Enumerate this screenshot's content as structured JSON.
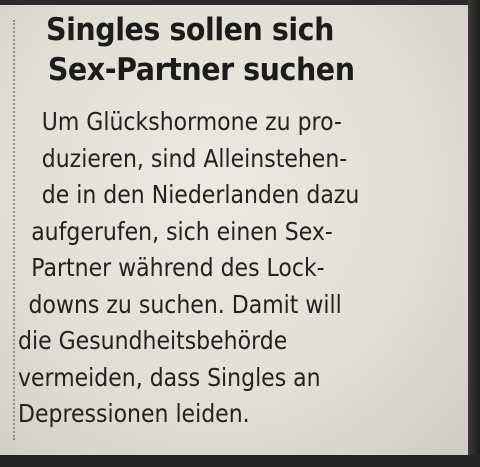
{
  "article": {
    "headline": [
      "Singles sollen sich",
      "Sex-Partner suchen"
    ],
    "body_lines": [
      "Um Glückshormone zu pro-",
      "duzieren, sind Alleinstehen-",
      "de in den Niederlanden dazu",
      "aufgerufen, sich einen Sex-",
      "Partner während des Lock-",
      "downs zu suchen. Damit will",
      "die Gesundheitsbehörde",
      "vermeiden, dass Singles an",
      "Depressionen leiden."
    ]
  },
  "colors": {
    "paper": "#e6e2d8",
    "ink": "#1c1c1c"
  }
}
